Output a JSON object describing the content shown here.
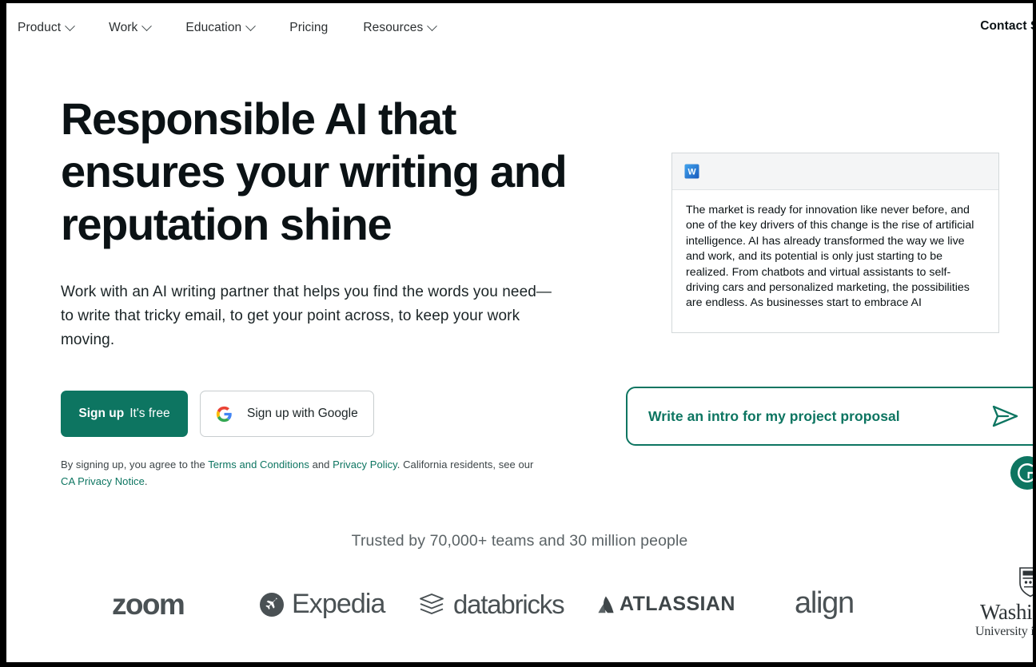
{
  "nav": {
    "items": [
      {
        "label": "Product",
        "has_caret": true
      },
      {
        "label": "Work",
        "has_caret": true
      },
      {
        "label": "Education",
        "has_caret": true
      },
      {
        "label": "Pricing",
        "has_caret": false
      },
      {
        "label": "Resources",
        "has_caret": true
      }
    ],
    "contact": "Contact Sales"
  },
  "hero": {
    "title": "Responsible AI that ensures your writing and reputation shine",
    "subtitle": "Work with an AI writing partner that helps you find the words you need—to write that tricky email, to get your point across, to keep your work moving.",
    "signup_bold": "Sign up",
    "signup_rest": "It's free",
    "google_label": "Sign up with Google",
    "google_icon": "google-g-icon",
    "legal": {
      "part1": "By signing up, you agree to the ",
      "link1": "Terms and Conditions",
      "part2": " and ",
      "link2": "Privacy Policy",
      "part3": ". California residents, see our ",
      "link3": "CA Privacy Notice",
      "part4": "."
    }
  },
  "document_card": {
    "app_icon": "microsoft-word-icon",
    "body_text": "The market is ready for innovation like never before, and one of the key drivers of this change is the rise of artificial intelligence. AI has already transformed the way we live and work, and its potential is only just starting to be realized. From chatbots and virtual assistants to self-driving cars and personalized marketing, the possibilities are endless. As businesses start to embrace AI"
  },
  "prompt_bar": {
    "text": "Write an intro for my project proposal",
    "send_icon": "send-paper-plane-icon"
  },
  "grammarly_badge": {
    "icon": "grammarly-g-icon"
  },
  "trust": {
    "heading": "Trusted by 70,000+ teams and 30 million people",
    "logos": [
      {
        "name": "zoom",
        "label": "zoom"
      },
      {
        "name": "expedia",
        "label": "Expedia"
      },
      {
        "name": "databricks",
        "label": "databricks"
      },
      {
        "name": "atlassian",
        "label": "ATLASSIAN"
      },
      {
        "name": "align",
        "label": "align"
      },
      {
        "name": "washu",
        "label": "Washington",
        "sublabel": "University in St.Louis"
      }
    ]
  },
  "colors": {
    "brand_teal": "#0d7561",
    "text_dark": "#0b1215",
    "text_muted": "#5b6366",
    "logo_gray": "#4a5154"
  }
}
